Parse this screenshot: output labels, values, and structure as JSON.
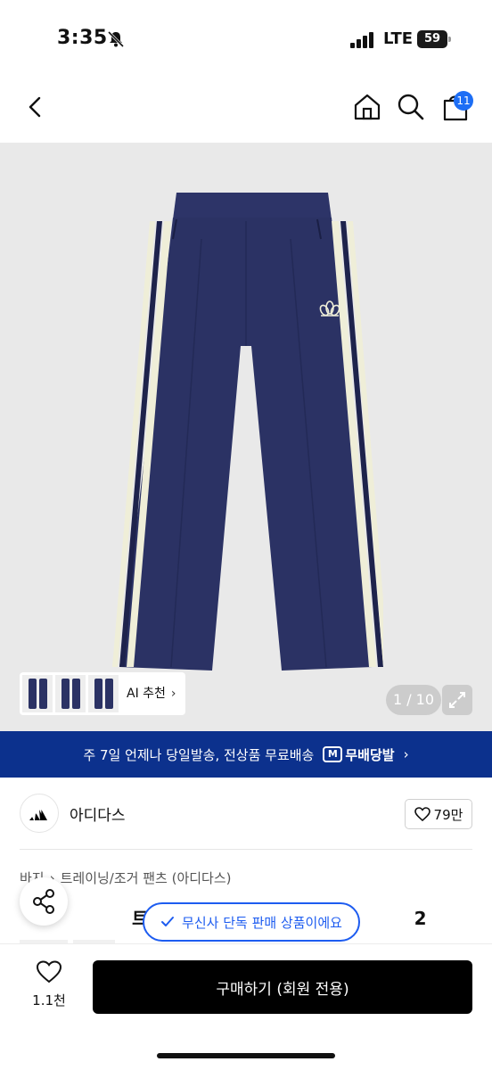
{
  "status_bar": {
    "time": "3:35",
    "network": "LTE",
    "battery": "59"
  },
  "nav": {
    "cart_count": "11",
    "icons": [
      "back-icon",
      "home-icon",
      "search-icon",
      "cart-icon"
    ]
  },
  "gallery": {
    "ai_recommend": "AI 추천",
    "page_counter": "1 / 10"
  },
  "banner": {
    "text": "주 7일 언제나 당일발송, 전상품 무료배송",
    "brand": "무배당발"
  },
  "brand": {
    "name": "아디다스",
    "likes": "79만"
  },
  "breadcrumb": {
    "category": "바지",
    "subcategory": "트레이닝/조거 팬츠 (아디다스)"
  },
  "product": {
    "title_left": "트랙 팬츠",
    "title_right": "2",
    "exclusive": "무신사 단독 판매 상품이에요"
  },
  "bottom_bar": {
    "wish_count": "1.1천",
    "buy_label": "구매하기 (회원 전용)"
  },
  "colors": {
    "accent_blue": "#1d5cf0",
    "banner_navy": "#0c318d",
    "pants_navy": "#2b3264",
    "stripe_cream": "#efeed8"
  }
}
